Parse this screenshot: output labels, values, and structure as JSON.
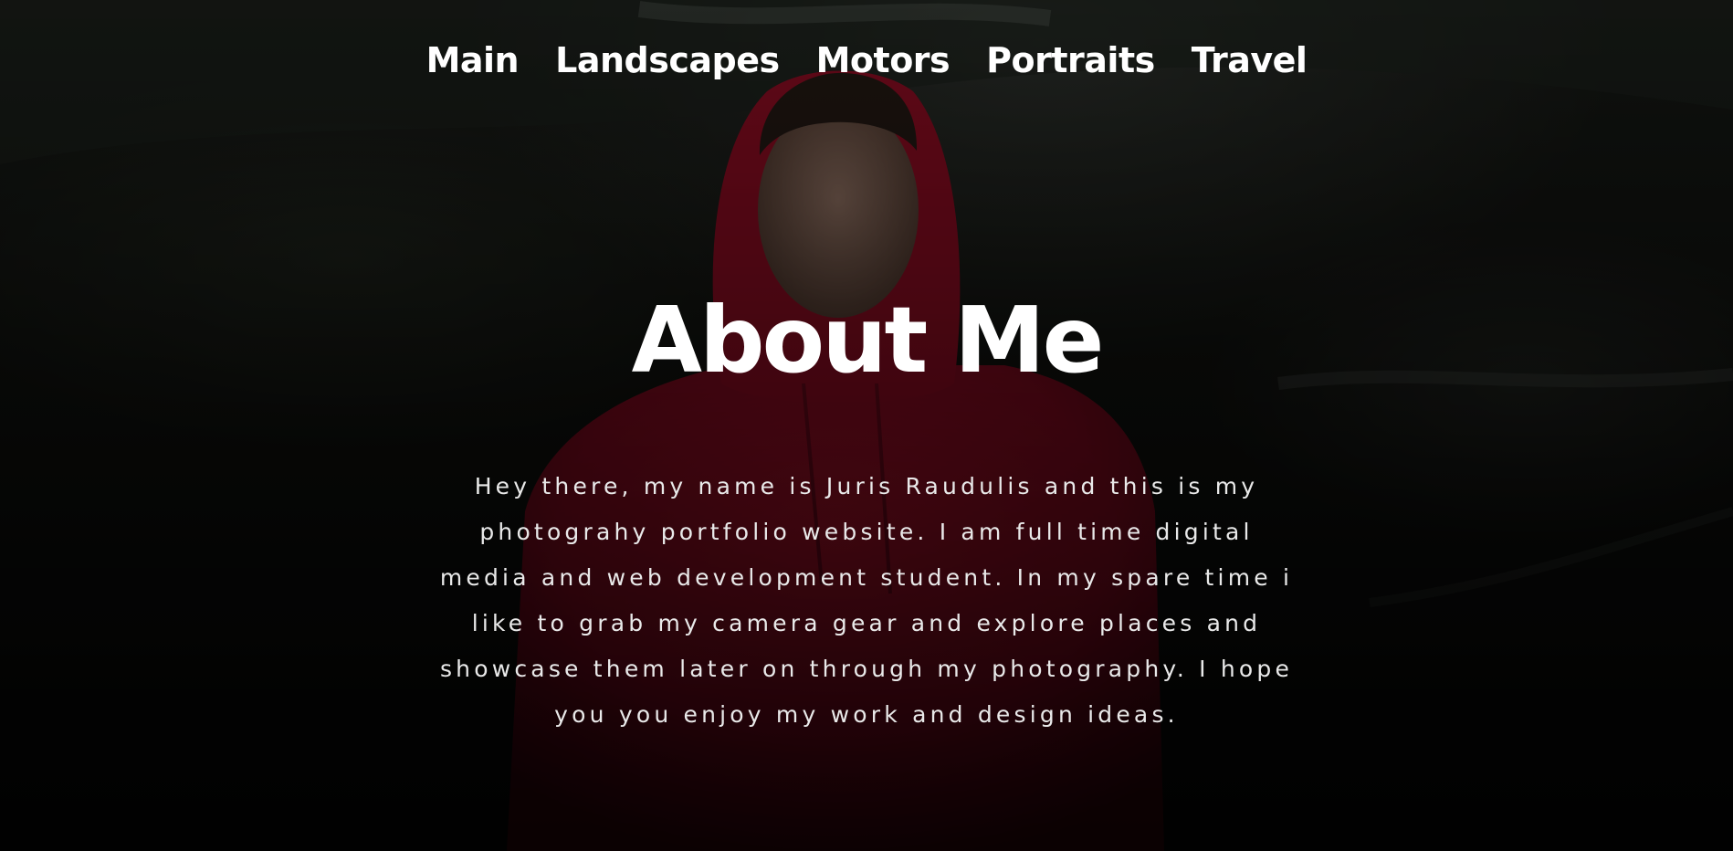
{
  "nav": {
    "items": [
      {
        "label": "Main"
      },
      {
        "label": "Landscapes"
      },
      {
        "label": "Motors"
      },
      {
        "label": "Portraits"
      },
      {
        "label": "Travel"
      }
    ]
  },
  "hero": {
    "title": "About Me",
    "intro": "Hey there, my name is Juris Raudulis and this is my photograhy portfolio website. I am full time digital media and web development student. In my spare time i like to grab my camera gear and explore places and showcase them later on through my photography. I hope you you enjoy my work and design ideas."
  },
  "colors": {
    "text": "#ffffff",
    "hoodie": "#b0102c",
    "background": "#141612"
  }
}
